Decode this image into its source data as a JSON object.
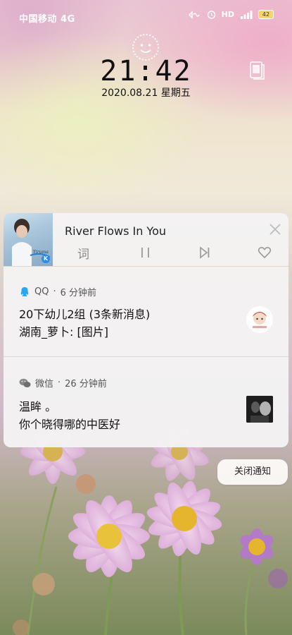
{
  "status_bar": {
    "carrier": "中国移动 4G",
    "hd": "HD",
    "network": "4G",
    "battery": "42",
    "icons": [
      "nfc-icon",
      "alarm-icon",
      "hd-icon",
      "signal-icon",
      "battery-icon"
    ]
  },
  "lockscreen": {
    "time": "21:42",
    "date": "2020.08.21 星期五",
    "icons": [
      "face-icon",
      "notes-icon"
    ]
  },
  "music": {
    "title": "River Flows In You",
    "album_text": "Yiruma",
    "album_badge": "K",
    "controls": [
      "词",
      "pause",
      "next",
      "like"
    ]
  },
  "notifications": [
    {
      "app": "QQ",
      "time": "6 分钟前",
      "title": "20下幼儿2组 (3条新消息)",
      "body": "湖南_萝卜: [图片]",
      "icon": "qq-icon"
    },
    {
      "app": "微信",
      "time": "26 分钟前",
      "title": "温眸 。",
      "body": "你个晓得哪的中医好",
      "icon": "wechat-icon"
    }
  ],
  "actions": {
    "close_notifications": "关闭通知"
  },
  "colors": {
    "card_bg": "#f4f2f2",
    "text": "#111111",
    "muted": "#888888",
    "qq_blue": "#2aa7f0",
    "wechat_gray": "#888888"
  }
}
